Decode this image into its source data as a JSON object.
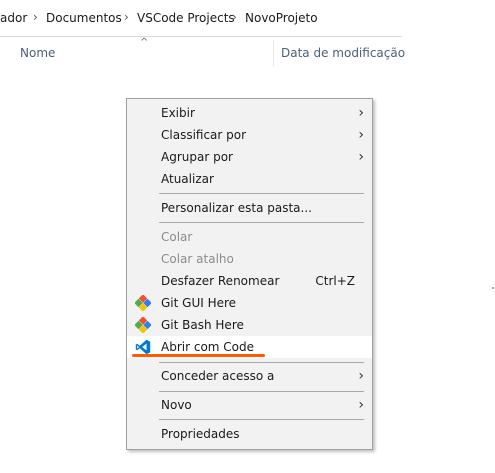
{
  "breadcrumb": {
    "items": [
      "ador",
      "Documentos",
      "VSCode Projects",
      "NovoProjeto"
    ],
    "separator": "›"
  },
  "columns": {
    "name": "Nome",
    "date_modified": "Data de modificação",
    "sort_indicator": "^"
  },
  "context_menu": {
    "items": [
      {
        "label": "Exibir",
        "submenu": true
      },
      {
        "label": "Classificar por",
        "submenu": true
      },
      {
        "label": "Agrupar por",
        "submenu": true
      },
      {
        "label": "Atualizar"
      },
      {
        "label": "Personalizar esta pasta..."
      },
      {
        "label": "Colar",
        "disabled": true
      },
      {
        "label": "Colar atalho",
        "disabled": true
      },
      {
        "label": "Desfazer Renomear",
        "shortcut": "Ctrl+Z"
      },
      {
        "label": "Git GUI Here",
        "icon": "git-icon"
      },
      {
        "label": "Git Bash Here",
        "icon": "git-icon"
      },
      {
        "label": "Abrir com Code",
        "icon": "vscode-icon"
      },
      {
        "label": "Conceder acesso a",
        "submenu": true
      },
      {
        "label": "Novo",
        "submenu": true
      },
      {
        "label": "Propriedades"
      }
    ],
    "submenu_arrow": "›"
  },
  "colors": {
    "annotation_underline": "#ff5a00",
    "vscode_blue": "#0078d4",
    "git_colors": [
      "#f05133",
      "#4cae4f",
      "#2f80ed",
      "#f5c400"
    ]
  }
}
